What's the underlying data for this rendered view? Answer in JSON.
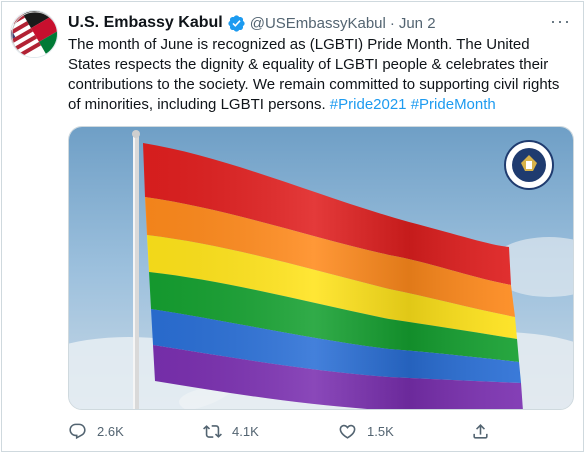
{
  "tweet": {
    "display_name": "U.S. Embassy Kabul",
    "handle": "@USEmbassyKabul",
    "separator": "·",
    "date": "Jun 2",
    "more_label": "···",
    "text_main": "The month of June is recognized as (LGBTI) Pride Month. The United States respects the dignity & equality of LGBTI people & celebrates their contributions to the society. We remain committed to supporting civil rights of minorities, including LGBTI persons.",
    "hashtags": [
      "#Pride2021",
      "#PrideMonth"
    ]
  },
  "actions": {
    "replies": "2.6K",
    "retweets": "4.1K",
    "likes": "1.5K"
  },
  "icons": {
    "verified": "verified-badge-icon",
    "reply": "reply-icon",
    "retweet": "retweet-icon",
    "like": "heart-icon",
    "share": "share-icon"
  },
  "colors": {
    "link": "#1d9bf0",
    "secondary_text": "#536471",
    "flag": [
      "#e40303",
      "#ff8c00",
      "#ffed00",
      "#008026",
      "#24408e",
      "#732982"
    ]
  }
}
